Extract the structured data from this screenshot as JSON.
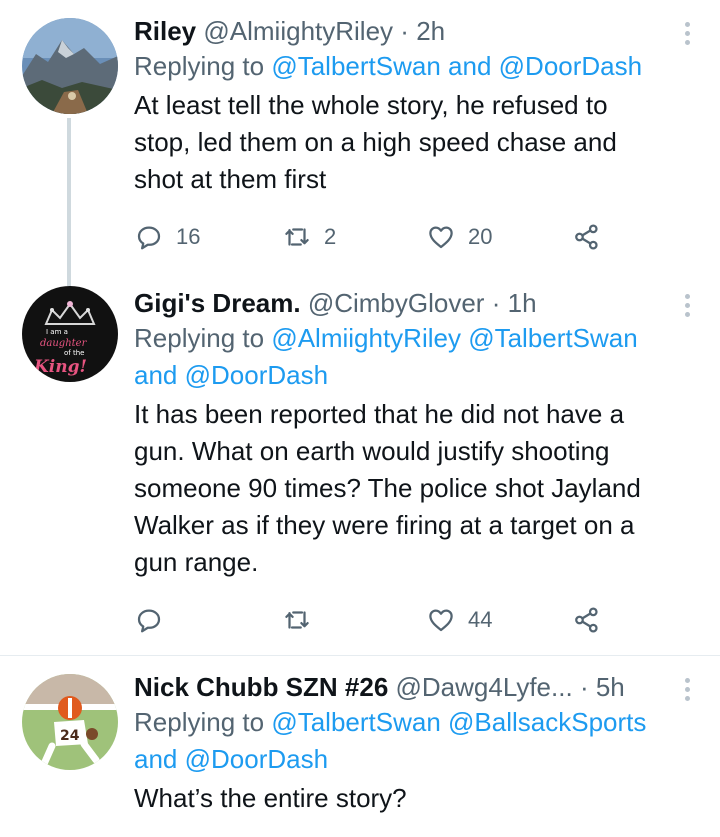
{
  "tweets": [
    {
      "display_name": "Riley",
      "handle": "@AlmiightyRiley",
      "time": "2h",
      "replying_prefix": "Replying to",
      "replying_to": [
        "@TalbertSwan",
        "@DoorDash"
      ],
      "replying_joiner": "and",
      "text_lines": [
        "At least tell the whole story, he refused to",
        "stop, led them on a high speed chase and",
        "shot at them first"
      ],
      "stats": {
        "replies": "16",
        "retweets": "2",
        "likes": "20"
      }
    },
    {
      "display_name": "Gigi's Dream.",
      "handle": "@CimbyGlover",
      "time": "1h",
      "replying_prefix": "Replying to",
      "replying_to": [
        "@AlmiightyRiley",
        "@TalbertSwan",
        "@DoorDash"
      ],
      "replying_joiner": "and",
      "avatar_text": [
        "I am a",
        "daughter",
        "of the",
        "King!"
      ],
      "text_lines": [
        "It has been reported that he did not have a",
        "gun. What on earth would justify shooting",
        "someone 90 times? The police shot Jayland",
        "Walker as if they were firing at a target on a",
        "gun range."
      ],
      "stats": {
        "replies": "",
        "retweets": "",
        "likes": "44"
      }
    },
    {
      "display_name": "Nick Chubb SZN #26",
      "handle": "@Dawg4Lyfe...",
      "time": "5h",
      "replying_prefix": "Replying to",
      "replying_to": [
        "@TalbertSwan",
        "@BallsackSports",
        "@DoorDash"
      ],
      "replying_joiner": "and",
      "avatar_jersey_number": "24",
      "text_lines": [
        "What’s the entire story?"
      ]
    }
  ],
  "colors": {
    "link": "#1d9bf0",
    "muted": "#536471",
    "text": "#0f1419",
    "thread_line": "#cfd9de"
  },
  "icons": [
    "reply-icon",
    "retweet-icon",
    "like-icon",
    "share-icon",
    "more-options-icon"
  ],
  "separator": "·"
}
